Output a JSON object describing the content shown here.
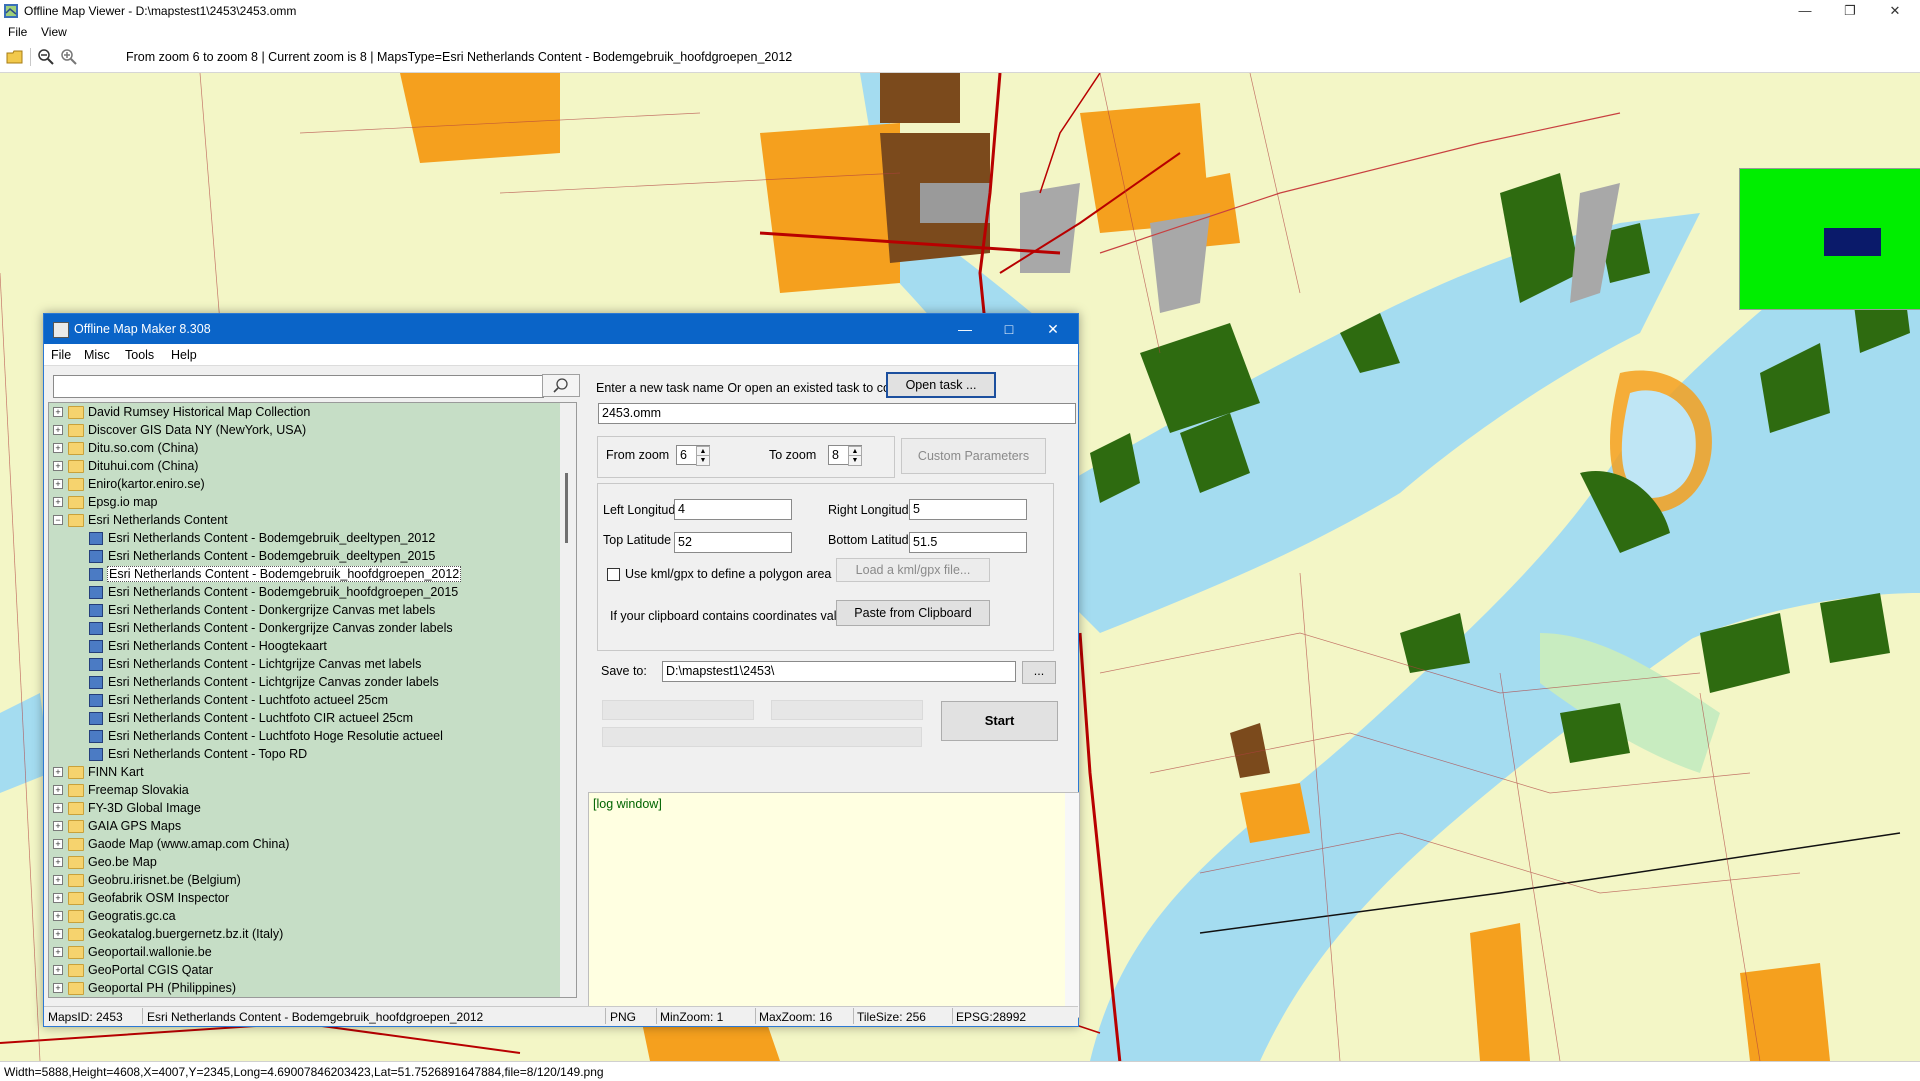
{
  "app": {
    "title": "Offline Map Viewer - D:\\mapstest1\\2453\\2453.omm",
    "menu": [
      "File",
      "View"
    ],
    "window_controls": [
      "—",
      "❐",
      "✕"
    ]
  },
  "toolbar": {
    "info": "From zoom 6 to zoom 8   |   Current zoom is 8   |   MapsType=Esri Netherlands Content - Bodemgebruik_hoofdgroepen_2012",
    "icons": [
      "open-folder-icon",
      "zoom-out-icon",
      "zoom-in-icon"
    ]
  },
  "statusbar": {
    "text": "Width=5888,Height=4608,X=4007,Y=2345,Long=4.69007846203423,Lat=51.7526891647884,file=8/120/149.png"
  },
  "colors": {
    "map_background": "#f3f6c6",
    "water": "#a4dcf0",
    "forest": "#2e6b10",
    "urban_orange": "#f5a01e",
    "urban_brown": "#7b4a1c",
    "roads": "#b80000",
    "minimap_green": "#00ee00",
    "minimap_view": "#0a1a6a",
    "dialog_title": "#0a64c8",
    "tree_bg": "#c6dec6",
    "log_bg": "#ffffe1"
  },
  "dialog": {
    "title": "Offline Map Maker 8.308",
    "menu": [
      "File",
      "Misc",
      "Tools",
      "Help"
    ],
    "search": {
      "value": "",
      "button_icon": "search-icon"
    },
    "tree": {
      "items": [
        {
          "label": "David Rumsey Historical Map Collection",
          "level": 0,
          "exp": "+"
        },
        {
          "label": "Discover GIS Data NY (NewYork, USA)",
          "level": 0,
          "exp": "+"
        },
        {
          "label": "Ditu.so.com (China)",
          "level": 0,
          "exp": "+"
        },
        {
          "label": "Dituhui.com (China)",
          "level": 0,
          "exp": "+"
        },
        {
          "label": "Eniro(kartor.eniro.se)",
          "level": 0,
          "exp": "+"
        },
        {
          "label": "Epsg.io map",
          "level": 0,
          "exp": "+"
        },
        {
          "label": "Esri Netherlands Content",
          "level": 0,
          "exp": "−"
        },
        {
          "label": "Esri Netherlands Content - Bodemgebruik_deeltypen_2012",
          "level": 1
        },
        {
          "label": "Esri Netherlands Content - Bodemgebruik_deeltypen_2015",
          "level": 1
        },
        {
          "label": "Esri Netherlands Content - Bodemgebruik_hoofdgroepen_2012",
          "level": 1,
          "selected": true
        },
        {
          "label": "Esri Netherlands Content - Bodemgebruik_hoofdgroepen_2015",
          "level": 1
        },
        {
          "label": "Esri Netherlands Content - Donkergrijze Canvas met labels",
          "level": 1
        },
        {
          "label": "Esri Netherlands Content - Donkergrijze Canvas zonder labels",
          "level": 1
        },
        {
          "label": "Esri Netherlands Content - Hoogtekaart",
          "level": 1
        },
        {
          "label": "Esri Netherlands Content - Lichtgrijze Canvas met labels",
          "level": 1
        },
        {
          "label": "Esri Netherlands Content - Lichtgrijze Canvas zonder labels",
          "level": 1
        },
        {
          "label": "Esri Netherlands Content - Luchtfoto actueel 25cm",
          "level": 1
        },
        {
          "label": "Esri Netherlands Content - Luchtfoto CIR actueel 25cm",
          "level": 1
        },
        {
          "label": "Esri Netherlands Content - Luchtfoto Hoge Resolutie actueel",
          "level": 1
        },
        {
          "label": "Esri Netherlands Content - Topo RD",
          "level": 1
        },
        {
          "label": "FINN Kart",
          "level": 0,
          "exp": "+"
        },
        {
          "label": "Freemap Slovakia",
          "level": 0,
          "exp": "+"
        },
        {
          "label": "FY-3D Global Image",
          "level": 0,
          "exp": "+"
        },
        {
          "label": "GAIA GPS Maps",
          "level": 0,
          "exp": "+"
        },
        {
          "label": "Gaode Map (www.amap.com China)",
          "level": 0,
          "exp": "+"
        },
        {
          "label": "Geo.be Map",
          "level": 0,
          "exp": "+"
        },
        {
          "label": "Geobru.irisnet.be (Belgium)",
          "level": 0,
          "exp": "+"
        },
        {
          "label": "Geofabrik OSM Inspector",
          "level": 0,
          "exp": "+"
        },
        {
          "label": "Geogratis.gc.ca",
          "level": 0,
          "exp": "+"
        },
        {
          "label": "Geokatalog.buergernetz.bz.it (Italy)",
          "level": 0,
          "exp": "+"
        },
        {
          "label": "Geoportail.wallonie.be",
          "level": 0,
          "exp": "+"
        },
        {
          "label": "GeoPortal CGIS Qatar",
          "level": 0,
          "exp": "+"
        },
        {
          "label": "Geoportal PH (Philippines)",
          "level": 0,
          "exp": "+"
        }
      ]
    },
    "task": {
      "prompt": "Enter a new task name Or open an existed task to continue:",
      "open_button": "Open task ...",
      "name": "2453.omm"
    },
    "zoom": {
      "from_label": "From zoom",
      "from_value": "6",
      "to_label": "To zoom",
      "to_value": "8",
      "custom_button": "Custom Parameters"
    },
    "coords": {
      "left_label": "Left Longitude",
      "left_value": "4",
      "right_label": "Right Longitude",
      "right_value": "5",
      "top_label": "Top Latitude",
      "top_value": "52",
      "bottom_label": "Bottom Latitude",
      "bottom_value": "51.5",
      "kml_label": "Use kml/gpx to define a polygon area",
      "kml_button": "Load a kml/gpx file...",
      "clipboard_label": "If your clipboard contains coordinates values:",
      "clipboard_button": "Paste from Clipboard"
    },
    "save": {
      "label": "Save to:",
      "path": "D:\\mapstest1\\2453\\",
      "browse": "..."
    },
    "start_button": "Start",
    "log": {
      "text": "[log window]"
    },
    "status": {
      "maps_id": "MapsID: 2453",
      "maps_name": "Esri Netherlands Content - Bodemgebruik_hoofdgroepen_2012",
      "format": "PNG",
      "min_zoom": "MinZoom: 1",
      "max_zoom": "MaxZoom: 16",
      "tile_size": "TileSize: 256",
      "epsg": "EPSG:28992"
    }
  }
}
